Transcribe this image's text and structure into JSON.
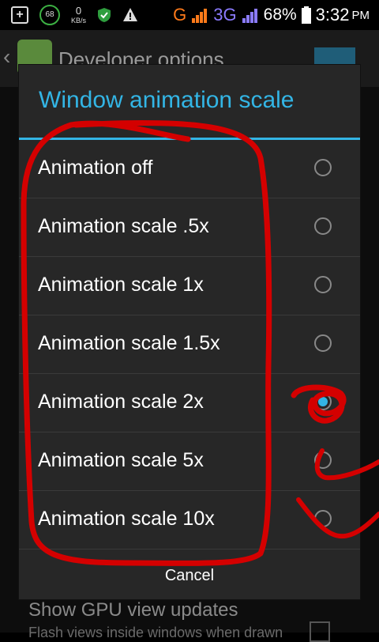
{
  "status_bar": {
    "ring_value": "68",
    "kbs_value": "0",
    "kbs_unit": "KB/s",
    "carrier_g": "G",
    "network_3g": "3G",
    "battery": "68%",
    "time": "3:32",
    "ampm": "PM"
  },
  "app": {
    "title": "Developer options"
  },
  "dialog": {
    "title": "Window animation scale",
    "options": [
      {
        "label": "Animation off",
        "selected": false
      },
      {
        "label": "Animation scale .5x",
        "selected": false
      },
      {
        "label": "Animation scale 1x",
        "selected": false
      },
      {
        "label": "Animation scale 1.5x",
        "selected": false
      },
      {
        "label": "Animation scale 2x",
        "selected": true
      },
      {
        "label": "Animation scale 5x",
        "selected": false
      },
      {
        "label": "Animation scale 10x",
        "selected": false
      }
    ],
    "cancel_label": "Cancel"
  },
  "background_list": {
    "item_title": "Show GPU view updates",
    "item_subtitle": "Flash views inside windows when drawn"
  },
  "colors": {
    "accent": "#33b5e5",
    "annotation": "#d40000"
  }
}
